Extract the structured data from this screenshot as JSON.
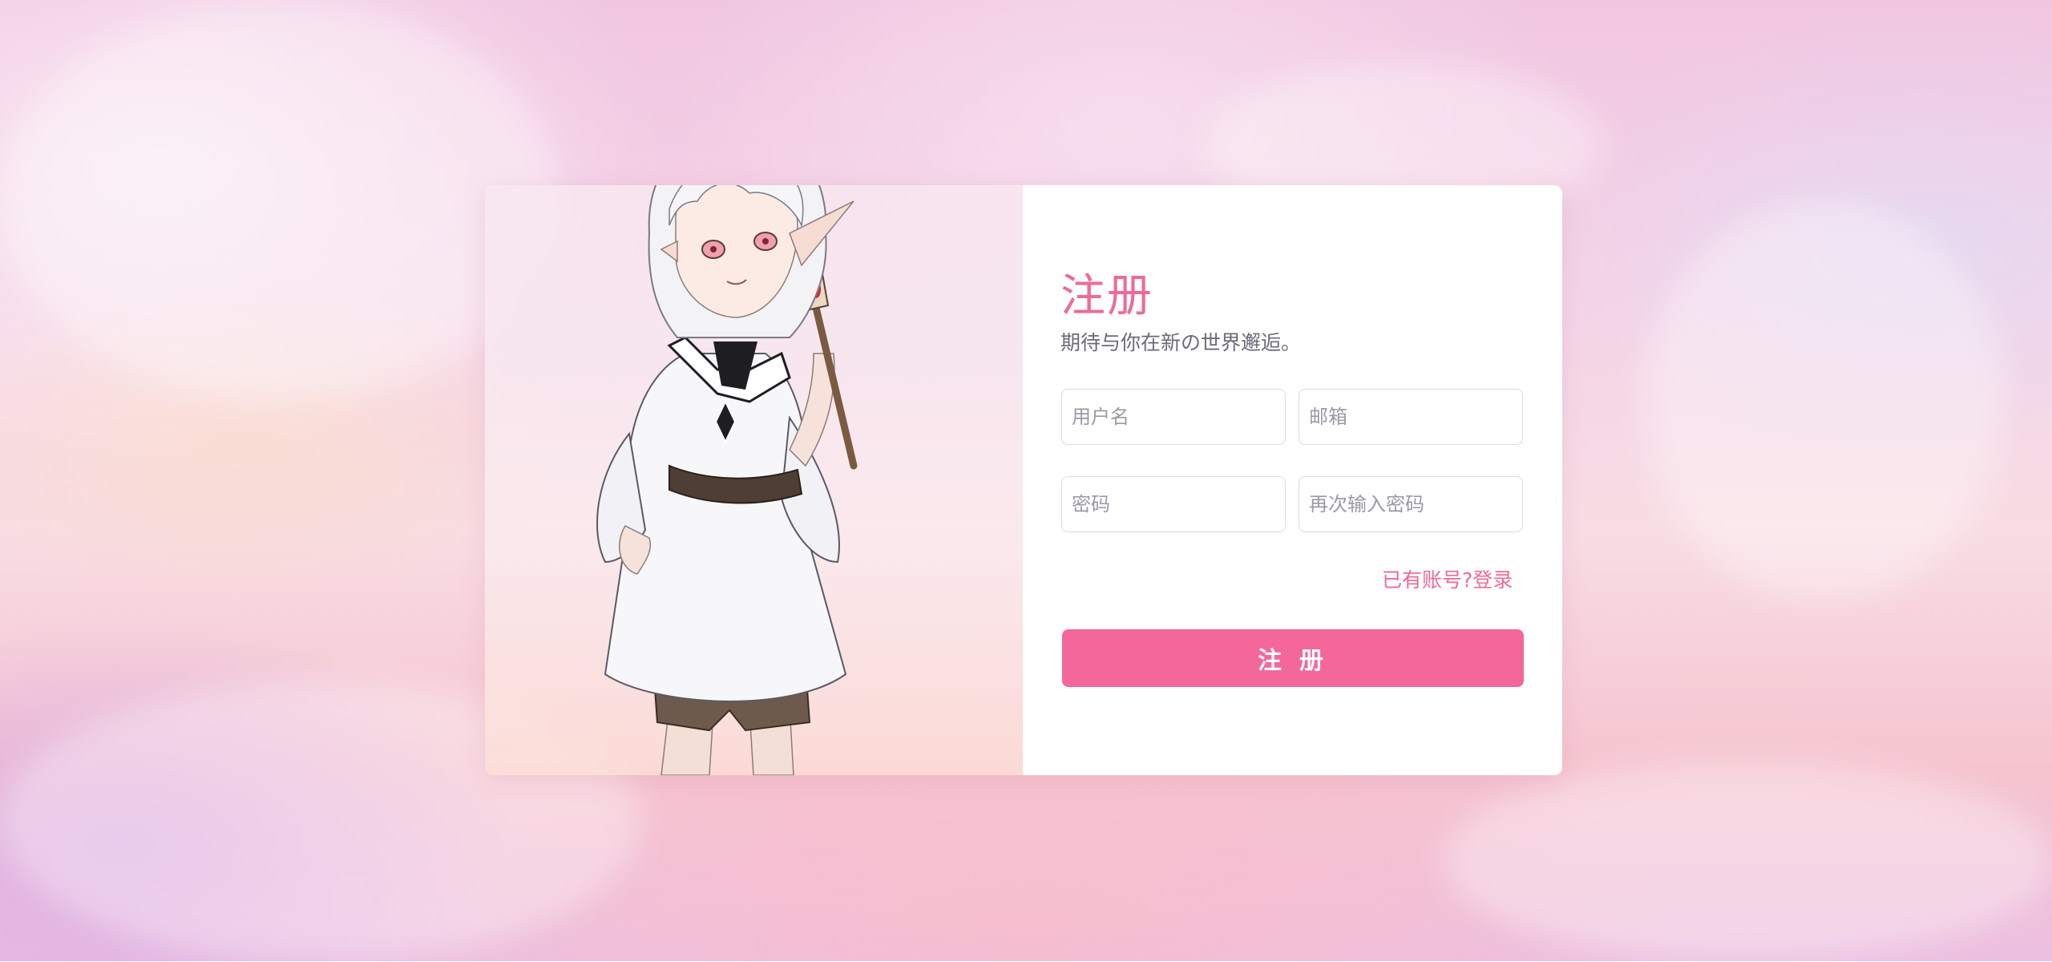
{
  "register": {
    "title": "注册",
    "subtitle": "期待与你在新の世界邂逅。",
    "username_placeholder": "用户名",
    "email_placeholder": "邮箱",
    "password_placeholder": "密码",
    "confirm_password_placeholder": "再次输入密码",
    "login_link": "已有账号?登录",
    "submit_label": "注册"
  },
  "colors": {
    "accent": "#f4679a",
    "title": "#ef6a94",
    "subtitle": "#6b6b7a"
  }
}
